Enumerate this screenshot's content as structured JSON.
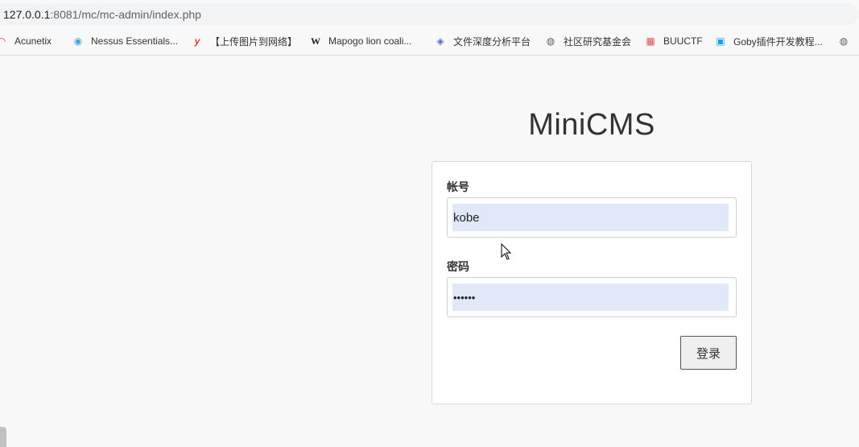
{
  "browser": {
    "url_host": "127.0.0.1",
    "url_rest": ":8081/mc/mc-admin/index.php"
  },
  "bookmarks": [
    {
      "label": "Acunetix",
      "icon": "acunetix-icon",
      "glyph": "◠",
      "color": "#e8392c"
    },
    {
      "label": "Nessus Essentials...",
      "icon": "nessus-icon",
      "glyph": "◉",
      "color": "#4aa3df"
    },
    {
      "label": "【上传图片到网络】",
      "icon": "y-logo-icon",
      "glyph": "y",
      "color": "#e8392c"
    },
    {
      "label": "Mapogo lion coali...",
      "icon": "wikipedia-icon",
      "glyph": "W",
      "color": "#222222"
    },
    {
      "label": "文件深度分析平台",
      "icon": "eye-icon",
      "glyph": "◈",
      "color": "#5b6cc4"
    },
    {
      "label": "社区研究基金会",
      "icon": "globe-icon",
      "glyph": "◍",
      "color": "#5f6368"
    },
    {
      "label": "BUUCTF",
      "icon": "buuctf-icon",
      "glyph": "▦",
      "color": "#d9534f"
    },
    {
      "label": "Goby插件开发教程...",
      "icon": "bilibili-icon",
      "glyph": "▣",
      "color": "#1e9fdf"
    },
    {
      "label": "",
      "icon": "globe-icon",
      "glyph": "◍",
      "color": "#5f6368"
    }
  ],
  "login": {
    "title": "MiniCMS",
    "username_label": "帐号",
    "username_value": "kobe",
    "password_label": "密码",
    "password_value": "••••••",
    "submit_label": "登录"
  }
}
